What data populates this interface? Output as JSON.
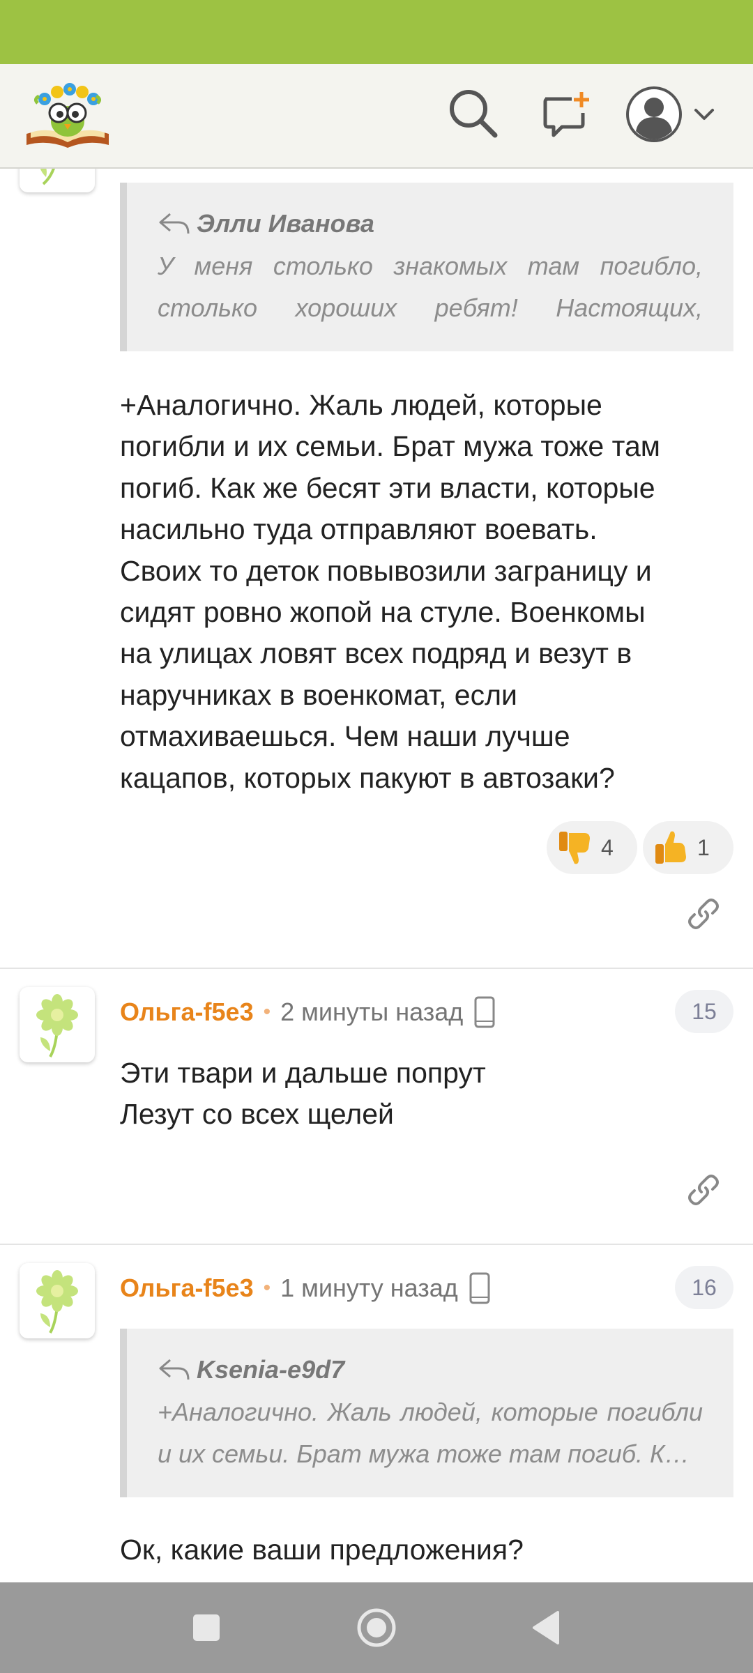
{
  "header": {
    "logo": "smiling-book-owl-logo",
    "icons": [
      "search-icon",
      "compose-message-icon",
      "profile-avatar-icon",
      "chevron-down-icon"
    ]
  },
  "comments": [
    {
      "quote": {
        "author": "Элли Иванова",
        "text": "У меня столько знакомых там погибло, столько хороших ребят! Настоящих, лучши…"
      },
      "text": "+Аналогично. Жаль людей, которые\nпогибли и их семьи. Брат мужа тоже там\nпогиб. Как же бесят эти власти, которые\nнасильно туда отправляют воевать.\nСвоих то деток повывозили заграницу и\nсидят ровно жопой на стуле. Военкомы\nна улицах ловят всех подряд и везут в\nнаручниках в военкомат, если\nотмахиваешься. Чем наши лучше\nкацапов, которых пакуют в автозаки?",
      "reactions": {
        "dislike": "4",
        "like": "1"
      }
    },
    {
      "author": "Ольга-f5e3",
      "time": "2 минуты назад",
      "number": "15",
      "text": "Эти твари и дальше попрут\nЛезут со всех щелей"
    },
    {
      "author": "Ольга-f5e3",
      "time": "1 минуту назад",
      "number": "16",
      "quote": {
        "author": "Ksenia-e9d7",
        "text": "+Аналогично. Жаль людей, которые погибли и их семьи. Брат мужа тоже там погиб. К…"
      },
      "text": "Ок, какие ваши предложения?"
    }
  ],
  "colors": {
    "status_bar": "#9dc243",
    "author": "#e8841a",
    "nav_bar": "#9a9a9a"
  }
}
